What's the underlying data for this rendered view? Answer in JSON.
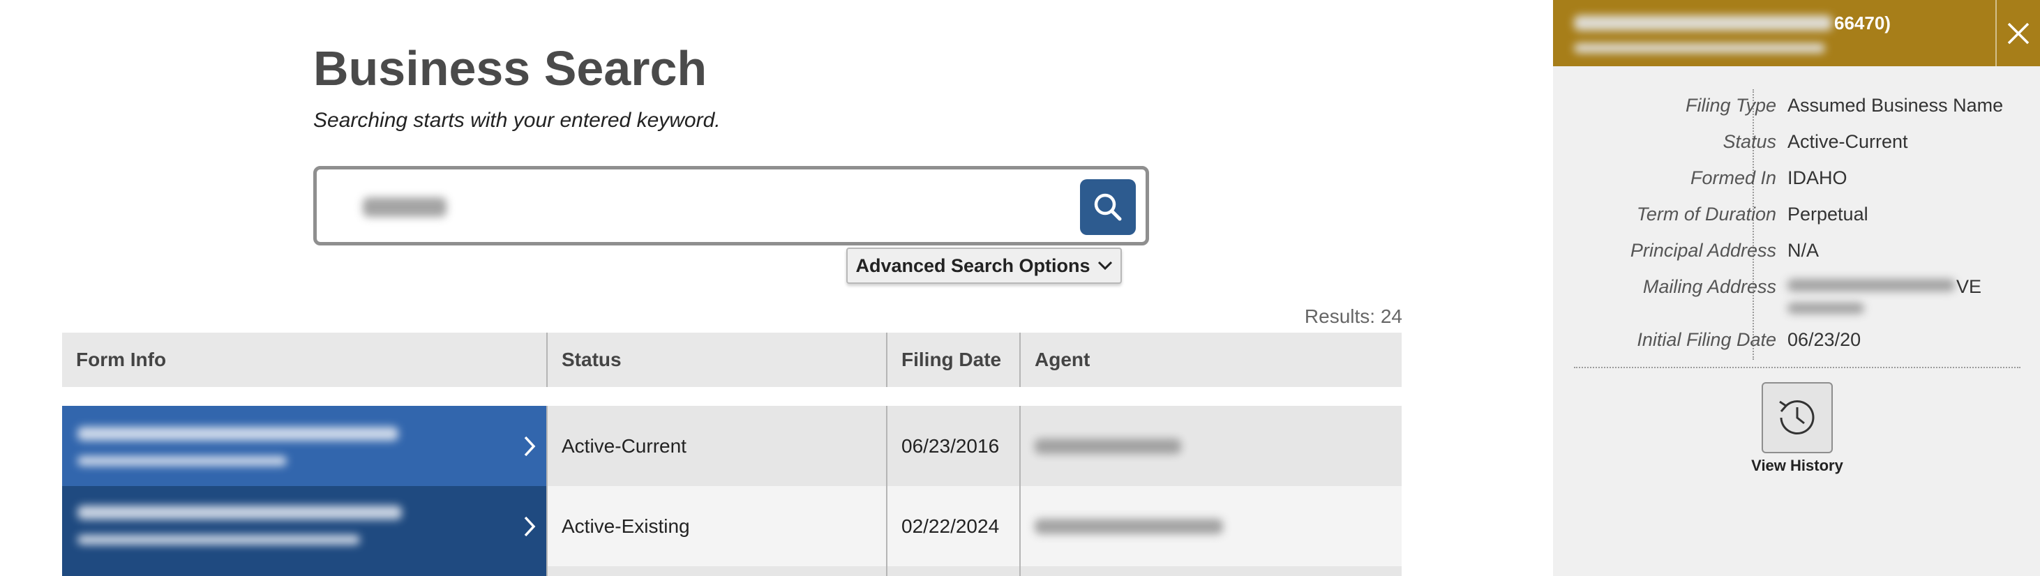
{
  "page": {
    "title": "Business Search",
    "subtitle": "Searching starts with your entered keyword."
  },
  "search": {
    "button_icon": "search-icon",
    "advanced_label": "Advanced Search Options",
    "advanced_icon": "chevron-down-icon"
  },
  "results_text": "Results: 24",
  "table": {
    "columns": [
      "Form Info",
      "Status",
      "Filing Date",
      "Agent"
    ],
    "rows": [
      {
        "status": "Active-Current",
        "filing_date": "06/23/2016"
      },
      {
        "status": "Active-Existing",
        "filing_date": "02/22/2024"
      }
    ]
  },
  "panel": {
    "header_suffix": "66470)",
    "close_icon": "close-icon",
    "details": [
      {
        "label": "Filing Type",
        "value": "Assumed Business Name"
      },
      {
        "label": "Status",
        "value": "Active-Current"
      },
      {
        "label": "Formed In",
        "value": "IDAHO"
      },
      {
        "label": "Term of Duration",
        "value": "Perpetual"
      },
      {
        "label": "Principal Address",
        "value": "N/A"
      },
      {
        "label": "Mailing Address",
        "value": "VE"
      },
      {
        "label": "Initial Filing Date",
        "value": "06/23/20"
      }
    ],
    "history_label": "View History",
    "history_icon": "history-icon"
  },
  "colors": {
    "row_selected": "#3266ad",
    "row_dark": "#1f4a80",
    "panel_header": "#a77e19",
    "search_button": "#2d5b8f"
  }
}
